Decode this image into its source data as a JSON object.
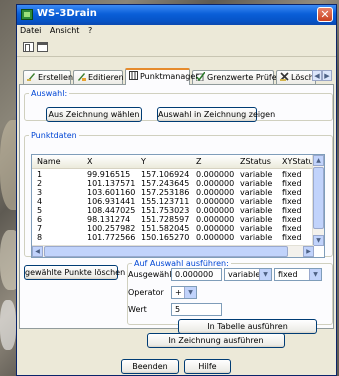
{
  "window": {
    "title": "WS-3Drain",
    "close_glyph": "✕"
  },
  "menu": [
    "Datei",
    "Ansicht",
    "?"
  ],
  "tabs": [
    {
      "label": "Erstellen",
      "icon": "create-icon"
    },
    {
      "label": "Editieren",
      "icon": "edit-icon"
    },
    {
      "label": "Punktmanager",
      "icon": "table-icon",
      "active": true
    },
    {
      "label": "Grenzwerte Prüfen",
      "icon": "check-icon"
    },
    {
      "label": "Löschen",
      "icon": "delete-icon"
    }
  ],
  "tab_scroll": {
    "left": "◀",
    "right": "▶"
  },
  "auswahl": {
    "legend": "Auswahl:",
    "btn_select": "Aus Zeichnung wählen",
    "btn_show": "Auswahl in Zeichnung zeigen"
  },
  "punktdaten": {
    "legend": "Punktdaten",
    "columns": [
      "Name",
      "X",
      "Y",
      "Z",
      "ZStatus",
      "XYStatus"
    ],
    "rows": [
      [
        "1",
        "99.916515",
        "157.106924",
        "0.000000",
        "variable",
        "fixed"
      ],
      [
        "2",
        "101.137571",
        "157.243645",
        "0.000000",
        "variable",
        "fixed"
      ],
      [
        "3",
        "103.601160",
        "157.253186",
        "0.000000",
        "variable",
        "fixed"
      ],
      [
        "4",
        "106.931441",
        "155.123711",
        "0.000000",
        "variable",
        "fixed"
      ],
      [
        "5",
        "108.447025",
        "151.753023",
        "0.000000",
        "variable",
        "fixed"
      ],
      [
        "6",
        "98.131274",
        "151.728597",
        "0.000000",
        "variable",
        "fixed"
      ],
      [
        "7",
        "100.257982",
        "151.582045",
        "0.000000",
        "variable",
        "fixed"
      ],
      [
        "8",
        "101.772566",
        "150.165270",
        "0.000000",
        "variable",
        "fixed"
      ]
    ]
  },
  "actions": {
    "delete_btn": "gewählte Punkte löschen",
    "legend": "Auf Auswahl ausführen:",
    "label_selected": "Ausgewählt",
    "value_selected": "0.000000",
    "combo_status": "variable",
    "combo_xy": "fixed",
    "label_operator": "Operator",
    "combo_operator": "+",
    "label_value": "Wert",
    "value_value": "5",
    "btn_table": "In Tabelle ausführen",
    "btn_drawing": "In Zeichnung ausführen"
  },
  "footer": {
    "btn_close": "Beenden",
    "btn_help": "Hilfe"
  },
  "colors": {
    "accent": "#0046d5",
    "titlebar": "#0a5fd8",
    "active_tab": "#e68b2c"
  }
}
